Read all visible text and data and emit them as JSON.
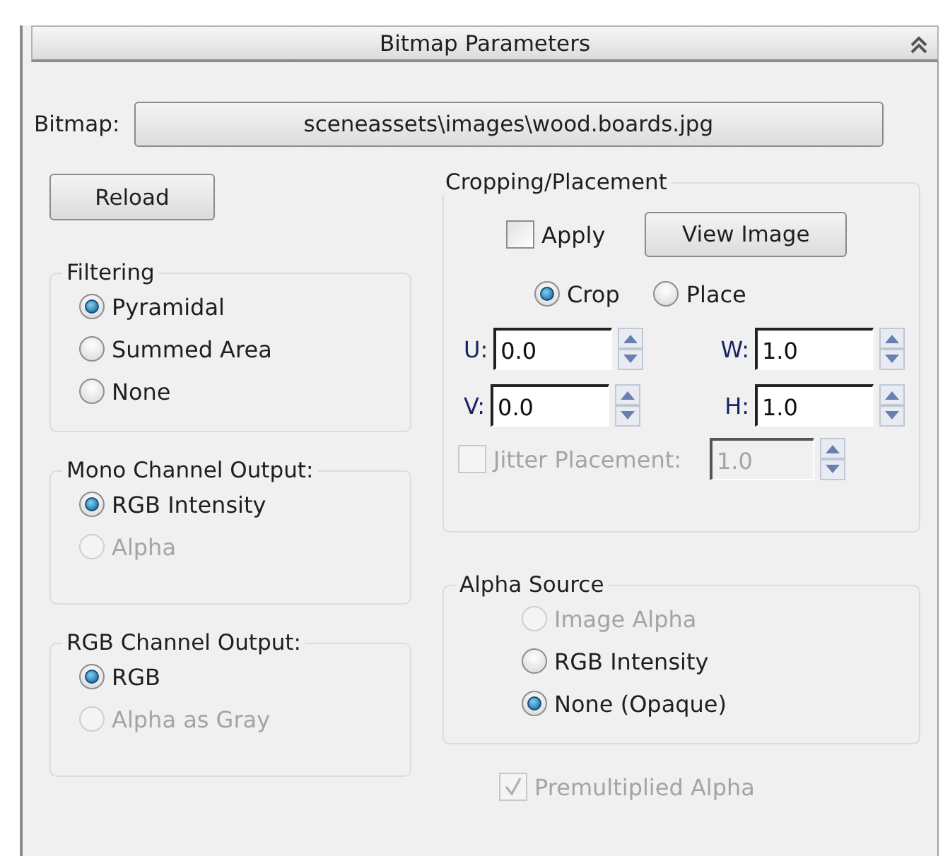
{
  "panel": {
    "title": "Bitmap Parameters",
    "expanded": true
  },
  "bitmap": {
    "label": "Bitmap:",
    "path": "sceneassets\\images\\wood.boards.jpg"
  },
  "reload_button": "Reload",
  "filtering": {
    "title": "Filtering",
    "options": [
      {
        "label": "Pyramidal",
        "selected": true,
        "disabled": false
      },
      {
        "label": "Summed Area",
        "selected": false,
        "disabled": false
      },
      {
        "label": "None",
        "selected": false,
        "disabled": false
      }
    ]
  },
  "mono_channel_output": {
    "title": "Mono Channel Output:",
    "options": [
      {
        "label": "RGB Intensity",
        "selected": true,
        "disabled": false
      },
      {
        "label": "Alpha",
        "selected": false,
        "disabled": true
      }
    ]
  },
  "rgb_channel_output": {
    "title": "RGB Channel Output:",
    "options": [
      {
        "label": "RGB",
        "selected": true,
        "disabled": false
      },
      {
        "label": "Alpha as Gray",
        "selected": false,
        "disabled": true
      }
    ]
  },
  "cropping_placement": {
    "title": "Cropping/Placement",
    "apply": {
      "label": "Apply",
      "checked": false,
      "disabled": false
    },
    "view_image_button": "View Image",
    "modes": [
      {
        "label": "Crop",
        "selected": true,
        "disabled": false
      },
      {
        "label": "Place",
        "selected": false,
        "disabled": false
      }
    ],
    "fields": [
      {
        "label": "U:",
        "value": "0.0",
        "disabled": false
      },
      {
        "label": "W:",
        "value": "1.0",
        "disabled": false
      },
      {
        "label": "V:",
        "value": "0.0",
        "disabled": false
      },
      {
        "label": "H:",
        "value": "1.0",
        "disabled": false
      }
    ],
    "jitter": {
      "label": "Jitter Placement:",
      "checked": false,
      "disabled": true,
      "value": "1.0"
    }
  },
  "alpha_source": {
    "title": "Alpha Source",
    "options": [
      {
        "label": "Image Alpha",
        "selected": false,
        "disabled": true
      },
      {
        "label": "RGB Intensity",
        "selected": false,
        "disabled": false
      },
      {
        "label": "None (Opaque)",
        "selected": true,
        "disabled": false
      }
    ]
  },
  "premultiplied_alpha": {
    "label": "Premultiplied Alpha",
    "checked": true,
    "disabled": true
  }
}
